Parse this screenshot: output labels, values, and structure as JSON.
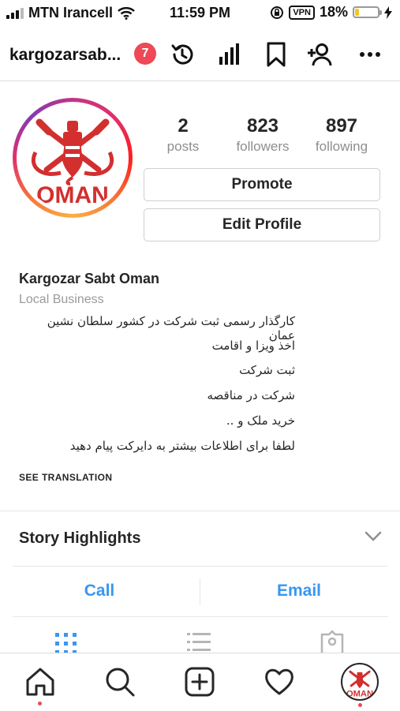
{
  "status_bar": {
    "carrier": "MTN Irancell",
    "time": "11:59 PM",
    "vpn": "VPN",
    "battery": "18%",
    "battery_level": 0.18
  },
  "header": {
    "username": "kargozarsab...",
    "notification_count": "7",
    "icons": [
      "history-icon",
      "insights-icon",
      "bookmark-icon",
      "add-person-icon",
      "more-icon"
    ]
  },
  "profile": {
    "avatar_text": "OMAN",
    "stats": [
      {
        "value": "2",
        "label": "posts"
      },
      {
        "value": "823",
        "label": "followers"
      },
      {
        "value": "897",
        "label": "following"
      }
    ],
    "promote_label": "Promote",
    "edit_label": "Edit Profile",
    "name": "Kargozar Sabt Oman",
    "category": "Local Business",
    "bio_lines": [
      "کارگذار رسمی ثبت شرکت در کشور سلطان نشین عمان",
      "اخذ ویزا و اقامت",
      "ثبت شرکت",
      "شرکت در مناقصه",
      "خرید ملک و ..",
      "لطفا برای اطلاعات بیشتر به دایرکت پیام دهید"
    ],
    "see_translation": "SEE TRANSLATION"
  },
  "highlights": {
    "title": "Story Highlights"
  },
  "actions": {
    "call": "Call",
    "email": "Email"
  },
  "tabs": [
    "grid-icon",
    "list-icon",
    "tagged-icon"
  ],
  "bottom_nav": [
    "home-icon",
    "search-icon",
    "new-post-icon",
    "activity-icon",
    "profile-avatar"
  ],
  "colors": {
    "accent_blue": "#3897f0",
    "badge_red": "#ed4956",
    "oman_red": "#d32f2f"
  }
}
